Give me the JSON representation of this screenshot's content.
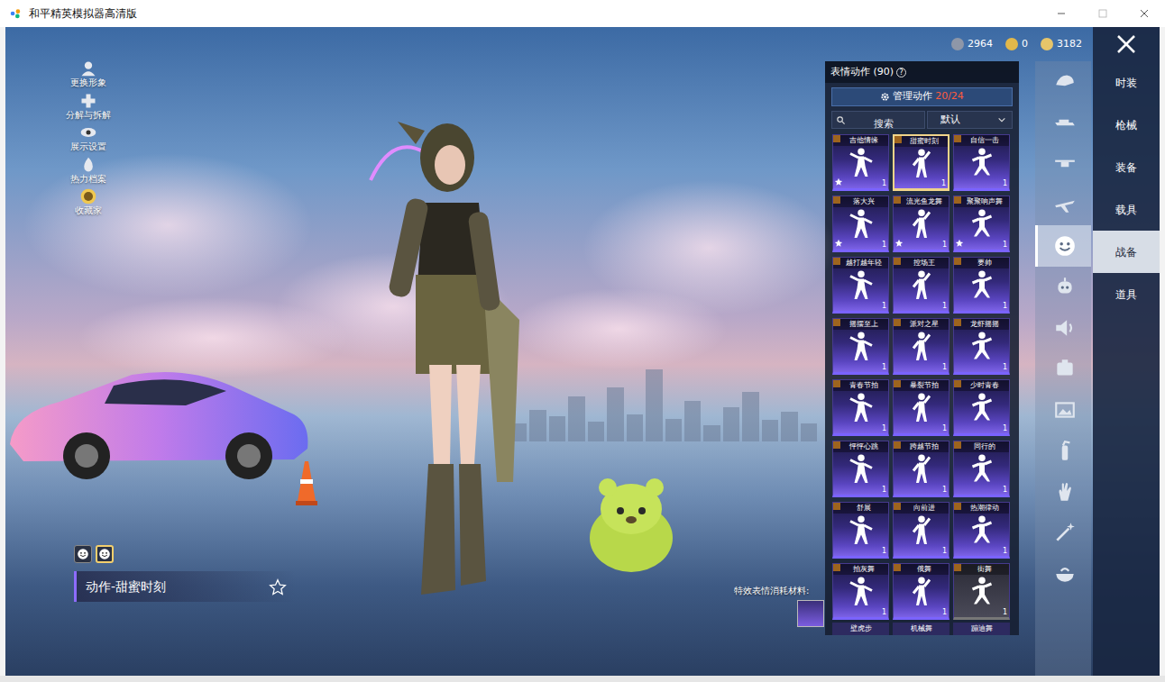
{
  "window": {
    "title": "和平精英模拟器高清版"
  },
  "left_menu": [
    {
      "label": "更换形象"
    },
    {
      "label": "分解与拆解"
    },
    {
      "label": "展示设置"
    },
    {
      "label": "热力档案"
    },
    {
      "label": "收藏家"
    }
  ],
  "currencies": [
    "2964",
    "0",
    "3182"
  ],
  "categories": [
    {
      "label": "时装",
      "selected": false
    },
    {
      "label": "枪械",
      "selected": false
    },
    {
      "label": "装备",
      "selected": false
    },
    {
      "label": "载具",
      "selected": false
    },
    {
      "label": "战备",
      "selected": true
    },
    {
      "label": "道具",
      "selected": false
    }
  ],
  "icon_tabs": [
    {
      "selected": false
    },
    {
      "selected": false
    },
    {
      "selected": false
    },
    {
      "selected": false
    },
    {
      "selected": true
    },
    {
      "selected": false
    },
    {
      "selected": false
    },
    {
      "selected": false
    },
    {
      "selected": false
    },
    {
      "selected": false
    },
    {
      "selected": false
    },
    {
      "selected": false
    },
    {
      "selected": false
    }
  ],
  "panel": {
    "title": "表情动作 (90)",
    "help": "?",
    "manage_label": "管理动作",
    "manage_count": "20/24",
    "search_placeholder": "搜索",
    "sort": "默认",
    "emotes": [
      {
        "label": "吉他情缘",
        "count": "1",
        "selected": false,
        "starred": true,
        "locked": false
      },
      {
        "label": "甜蜜时刻",
        "count": "1",
        "selected": true,
        "starred": false,
        "locked": false
      },
      {
        "label": "自信一击",
        "count": "1",
        "selected": false,
        "starred": false,
        "locked": false
      },
      {
        "label": "落大兴",
        "count": "1",
        "selected": false,
        "starred": true,
        "locked": false
      },
      {
        "label": "流光鱼龙舞",
        "count": "1",
        "selected": false,
        "starred": true,
        "locked": false
      },
      {
        "label": "聚聚响声舞",
        "count": "1",
        "selected": false,
        "starred": true,
        "locked": false
      },
      {
        "label": "越打越年轻",
        "count": "1",
        "selected": false,
        "starred": false,
        "locked": false
      },
      {
        "label": "控场王",
        "count": "1",
        "selected": false,
        "starred": false,
        "locked": false
      },
      {
        "label": "要帅",
        "count": "1",
        "selected": false,
        "starred": false,
        "locked": false
      },
      {
        "label": "摇摆至上",
        "count": "1",
        "selected": false,
        "starred": false,
        "locked": false
      },
      {
        "label": "派对之星",
        "count": "1",
        "selected": false,
        "starred": false,
        "locked": false
      },
      {
        "label": "龙虾摇摇",
        "count": "1",
        "selected": false,
        "starred": false,
        "locked": false
      },
      {
        "label": "青春节拍",
        "count": "1",
        "selected": false,
        "starred": false,
        "locked": false
      },
      {
        "label": "暴裂节拍",
        "count": "1",
        "selected": false,
        "starred": false,
        "locked": false
      },
      {
        "label": "少时青春",
        "count": "1",
        "selected": false,
        "starred": false,
        "locked": false
      },
      {
        "label": "怦怦心跳",
        "count": "1",
        "selected": false,
        "starred": false,
        "locked": false
      },
      {
        "label": "跨越节拍",
        "count": "1",
        "selected": false,
        "starred": false,
        "locked": false
      },
      {
        "label": "同行的",
        "count": "1",
        "selected": false,
        "starred": false,
        "locked": false
      },
      {
        "label": "舒展",
        "count": "1",
        "selected": false,
        "starred": false,
        "locked": false
      },
      {
        "label": "向前进",
        "count": "1",
        "selected": false,
        "starred": false,
        "locked": false
      },
      {
        "label": "热潮律动",
        "count": "1",
        "selected": false,
        "starred": false,
        "locked": false
      },
      {
        "label": "拍灰舞",
        "count": "1",
        "selected": false,
        "starred": false,
        "locked": false
      },
      {
        "label": "俄舞",
        "count": "1",
        "selected": false,
        "starred": false,
        "locked": false
      },
      {
        "label": "街舞",
        "count": "1",
        "selected": false,
        "starred": false,
        "locked": true
      }
    ],
    "next_row": [
      "壁虎步",
      "机械舞",
      "蹦迪舞"
    ]
  },
  "bottom": {
    "slots": [
      {
        "selected": false
      },
      {
        "selected": true
      }
    ],
    "current": "动作-甜蜜时刻",
    "material_label": "特效表情消耗材料:"
  }
}
